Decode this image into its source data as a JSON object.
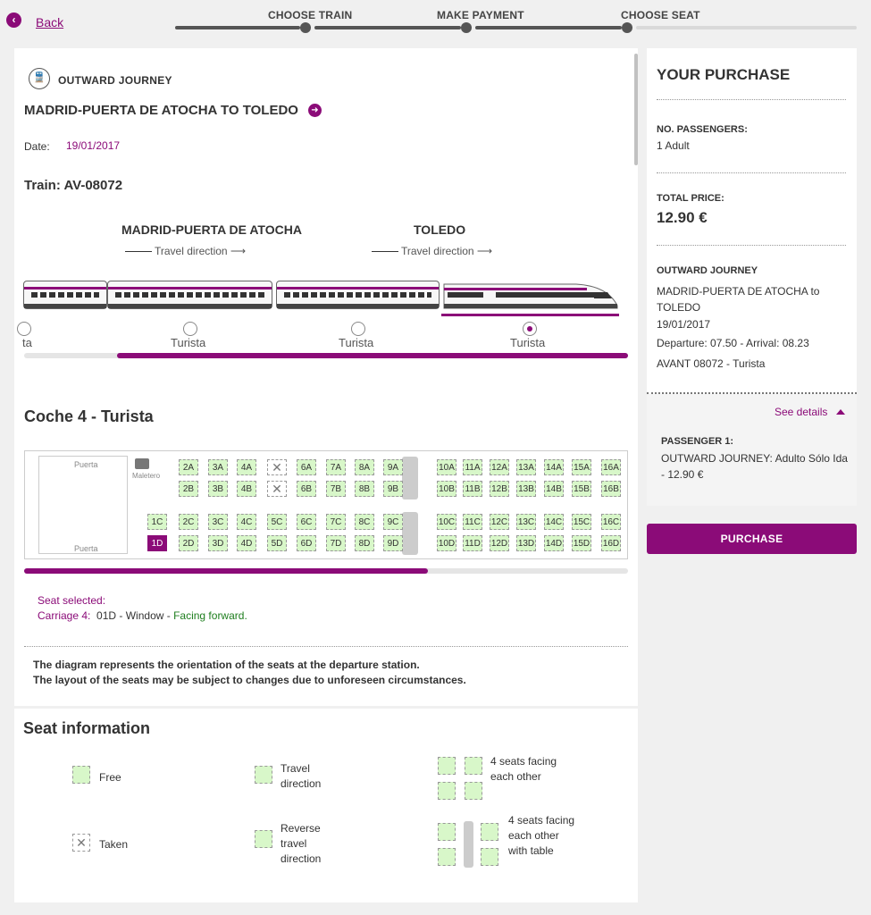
{
  "nav": {
    "back_label": "Back"
  },
  "steps": [
    {
      "label": "CHOOSE TRAIN"
    },
    {
      "label": "MAKE PAYMENT"
    },
    {
      "label": "CHOOSE SEAT"
    }
  ],
  "journey": {
    "outward_label": "OUTWARD JOURNEY",
    "route": "MADRID-PUERTA DE ATOCHA TO TOLEDO",
    "date_label": "Date:",
    "date_value": "19/01/2017",
    "train": "Train: AV-08072"
  },
  "train_diagram": {
    "origin": "MADRID-PUERTA DE ATOCHA",
    "destination": "TOLEDO",
    "travel_direction": "Travel direction",
    "car_classes": [
      "ta",
      "Turista",
      "Turista",
      "Turista"
    ],
    "selected_car_index": 3
  },
  "coach": {
    "title": "Coche 4 - Turista",
    "door_label": "Puerta",
    "luggage_label": "Maletero",
    "rows_top_a": [
      "2A",
      "3A",
      "4A",
      "x",
      "6A",
      "7A",
      "8A",
      "9A",
      "10A",
      "11A",
      "12A",
      "13A",
      "14A",
      "15A",
      "16A"
    ],
    "rows_top_b": [
      "2B",
      "3B",
      "4B",
      "x",
      "6B",
      "7B",
      "8B",
      "9B",
      "10B",
      "11B",
      "12B",
      "13B",
      "14B",
      "15B",
      "16B"
    ],
    "rows_bottom_c": [
      "1C",
      "2C",
      "3C",
      "4C",
      "5C",
      "6C",
      "7C",
      "8C",
      "9C",
      "10C",
      "11C",
      "12C",
      "13C",
      "14C",
      "15C",
      "16C"
    ],
    "rows_bottom_d": [
      "1D",
      "2D",
      "3D",
      "4D",
      "5D",
      "6D",
      "7D",
      "8D",
      "9D",
      "10D",
      "11D",
      "12D",
      "13D",
      "14D",
      "15D",
      "16D"
    ],
    "selected_seat": "1D"
  },
  "selection": {
    "label": "Seat selected:",
    "carriage": "Carriage 4:",
    "seat": "01D - Window -",
    "orientation": "Facing forward."
  },
  "disclaimer": {
    "line1": "The diagram represents the orientation of the seats at the departure station.",
    "line2": "The layout of the seats may be subject to changes due to unforeseen circumstances."
  },
  "seat_info": {
    "title": "Seat information",
    "free": "Free",
    "taken": "Taken",
    "travel_direction": "Travel direction",
    "reverse": "Reverse travel direction",
    "four_facing": "4 seats facing each other",
    "four_table": "4 seats facing each other with table"
  },
  "purchase": {
    "title": "YOUR PURCHASE",
    "passengers_label": "NO. PASSENGERS:",
    "passengers_value": "1 Adult",
    "price_label": "TOTAL PRICE:",
    "price_value": "12.90 €",
    "journey_label": "OUTWARD JOURNEY",
    "journey_route": "MADRID-PUERTA DE ATOCHA to TOLEDO",
    "journey_date": "19/01/2017",
    "journey_times": "Departure: 07.50 - Arrival: 08.23",
    "journey_service": "AVANT 08072 - Turista",
    "see_details": "See details",
    "passenger_label": "PASSENGER 1:",
    "passenger_detail": "OUTWARD JOURNEY: Adulto Sólo Ida - 12.90 €",
    "button": "PURCHASE"
  },
  "colors": {
    "accent": "#8b0b78",
    "seat_free": "#d8f7c9",
    "facing_forward": "#1e7e1e"
  }
}
